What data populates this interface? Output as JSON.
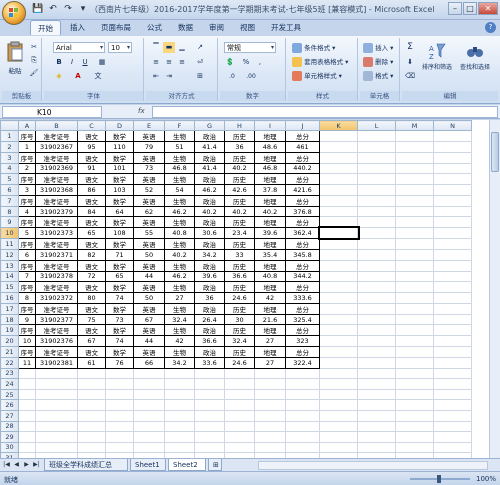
{
  "window": {
    "title": "（西南片七年级）2016-2017学年度第一学期期末考试-七年级5班 [兼容模式] - Microsoft Excel",
    "controls": [
      "–",
      "□",
      "✕"
    ]
  },
  "qat": [
    "💾",
    "↶",
    "↷",
    "▾"
  ],
  "ribbon_tabs": [
    "开始",
    "插入",
    "页面布局",
    "公式",
    "数据",
    "审阅",
    "视图",
    "开发工具"
  ],
  "active_tab": 0,
  "ribbon": {
    "clipboard": {
      "label": "剪贴板",
      "paste": "粘贴"
    },
    "font": {
      "label": "字体",
      "name": "Arial",
      "size": "10",
      "bold": "B",
      "italic": "I",
      "underline": "U",
      "grow": "A",
      "shrink": "A"
    },
    "alignment": {
      "label": "对齐方式"
    },
    "number": {
      "label": "数字",
      "format": "常规",
      "pct": "%",
      "comma": ",",
      "inc": ".0",
      "dec": ".00"
    },
    "styles": {
      "label": "样式",
      "cond": "条件格式",
      "table": "套用表格格式",
      "cell": "单元格样式"
    },
    "cells": {
      "label": "单元格",
      "insert": "插入",
      "delete": "删除",
      "format": "格式"
    },
    "editing": {
      "label": "编辑",
      "sum": "Σ",
      "sort": "排序和筛选",
      "find": "查找和选择"
    }
  },
  "formula_bar": {
    "name_box": "K10",
    "fx": "fx",
    "value": ""
  },
  "columns": [
    "A",
    "B",
    "C",
    "D",
    "E",
    "F",
    "G",
    "H",
    "I",
    "J",
    "K",
    "L",
    "M",
    "N"
  ],
  "rows": [
    [
      "序号",
      "准考证号",
      "语文",
      "数学",
      "英语",
      "生物",
      "政治",
      "历史",
      "地理",
      "总分"
    ],
    [
      "1",
      "31902367",
      "95",
      "110",
      "79",
      "51",
      "41.4",
      "36",
      "48.6",
      "461"
    ],
    [
      "序号",
      "准考证号",
      "语文",
      "数学",
      "英语",
      "生物",
      "政治",
      "历史",
      "地理",
      "总分"
    ],
    [
      "2",
      "31902369",
      "91",
      "101",
      "73",
      "46.8",
      "41.4",
      "40.2",
      "46.8",
      "440.2"
    ],
    [
      "序号",
      "准考证号",
      "语文",
      "数学",
      "英语",
      "生物",
      "政治",
      "历史",
      "地理",
      "总分"
    ],
    [
      "3",
      "31902368",
      "86",
      "103",
      "52",
      "54",
      "46.2",
      "42.6",
      "37.8",
      "421.6"
    ],
    [
      "序号",
      "准考证号",
      "语文",
      "数学",
      "英语",
      "生物",
      "政治",
      "历史",
      "地理",
      "总分"
    ],
    [
      "4",
      "31902379",
      "84",
      "64",
      "62",
      "46.2",
      "40.2",
      "40.2",
      "40.2",
      "376.8"
    ],
    [
      "序号",
      "准考证号",
      "语文",
      "数学",
      "英语",
      "生物",
      "政治",
      "历史",
      "地理",
      "总分"
    ],
    [
      "5",
      "31902373",
      "65",
      "108",
      "55",
      "40.8",
      "30.6",
      "23.4",
      "39.6",
      "362.4"
    ],
    [
      "序号",
      "准考证号",
      "语文",
      "数学",
      "英语",
      "生物",
      "政治",
      "历史",
      "地理",
      "总分"
    ],
    [
      "6",
      "31902371",
      "82",
      "71",
      "50",
      "40.2",
      "34.2",
      "33",
      "35.4",
      "345.8"
    ],
    [
      "序号",
      "准考证号",
      "语文",
      "数学",
      "英语",
      "生物",
      "政治",
      "历史",
      "地理",
      "总分"
    ],
    [
      "7",
      "31902378",
      "72",
      "65",
      "44",
      "46.2",
      "39.6",
      "36.6",
      "40.8",
      "344.2"
    ],
    [
      "序号",
      "准考证号",
      "语文",
      "数学",
      "英语",
      "生物",
      "政治",
      "历史",
      "地理",
      "总分"
    ],
    [
      "8",
      "31902372",
      "80",
      "74",
      "50",
      "27",
      "36",
      "24.6",
      "42",
      "333.6"
    ],
    [
      "序号",
      "准考证号",
      "语文",
      "数学",
      "英语",
      "生物",
      "政治",
      "历史",
      "地理",
      "总分"
    ],
    [
      "9",
      "31902377",
      "75",
      "73",
      "67",
      "32.4",
      "26.4",
      "30",
      "21.6",
      "325.4"
    ],
    [
      "序号",
      "准考证号",
      "语文",
      "数学",
      "英语",
      "生物",
      "政治",
      "历史",
      "地理",
      "总分"
    ],
    [
      "10",
      "31902376",
      "67",
      "74",
      "44",
      "42",
      "36.6",
      "32.4",
      "27",
      "323"
    ],
    [
      "序号",
      "准考证号",
      "语文",
      "数学",
      "英语",
      "生物",
      "政治",
      "历史",
      "地理",
      "总分"
    ],
    [
      "11",
      "31902381",
      "61",
      "76",
      "66",
      "34.2",
      "33.6",
      "24.6",
      "27",
      "322.4"
    ]
  ],
  "total_rows": 31,
  "sheet_tabs": [
    "班级全学科成绩汇总",
    "Sheet1",
    "Sheet2"
  ],
  "active_sheet": 2,
  "status": {
    "ready": "就绪",
    "zoom": "100%"
  }
}
